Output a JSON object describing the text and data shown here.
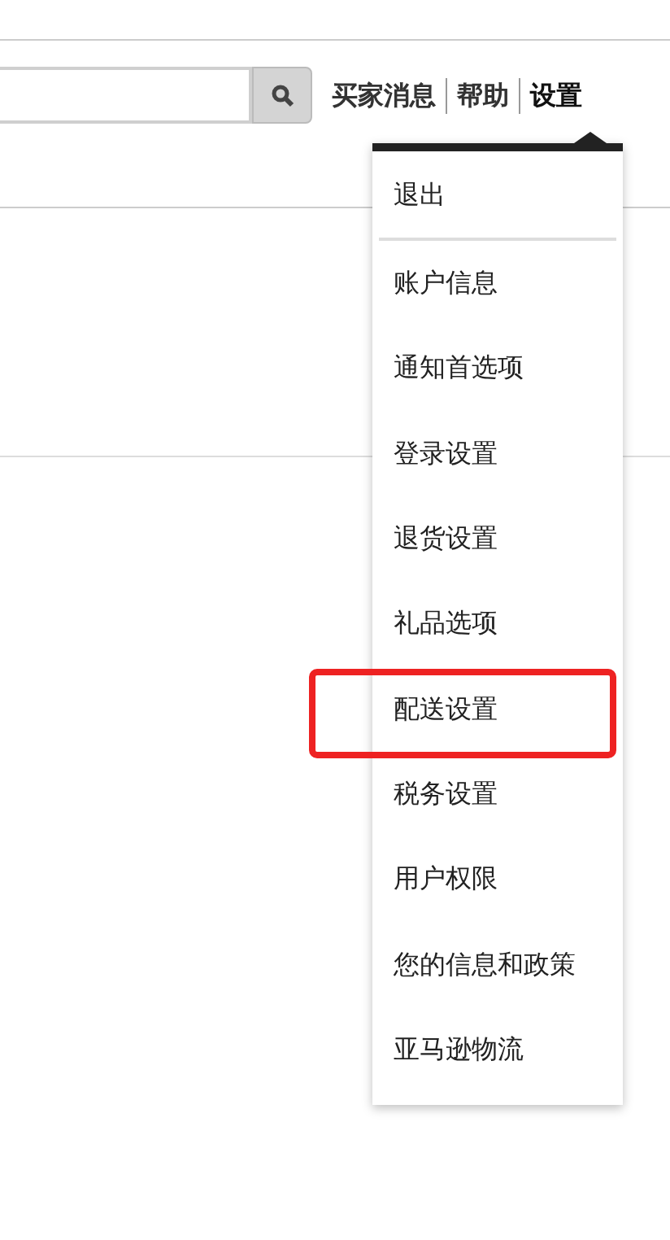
{
  "nav": [
    {
      "label": "买家消息",
      "selected": false
    },
    {
      "label": "帮助",
      "selected": false
    },
    {
      "label": "设置",
      "selected": true
    }
  ],
  "menu": {
    "logout": "退出",
    "items": [
      {
        "label": "账户信息",
        "highlighted": false
      },
      {
        "label": "通知首选项",
        "highlighted": false
      },
      {
        "label": "登录设置",
        "highlighted": false
      },
      {
        "label": "退货设置",
        "highlighted": false
      },
      {
        "label": "礼品选项",
        "highlighted": false
      },
      {
        "label": "配送设置",
        "highlighted": true
      },
      {
        "label": "税务设置",
        "highlighted": false
      },
      {
        "label": "用户权限",
        "highlighted": false
      },
      {
        "label": "您的信息和政策",
        "highlighted": false
      },
      {
        "label": "亚马逊物流",
        "highlighted": false
      }
    ]
  }
}
